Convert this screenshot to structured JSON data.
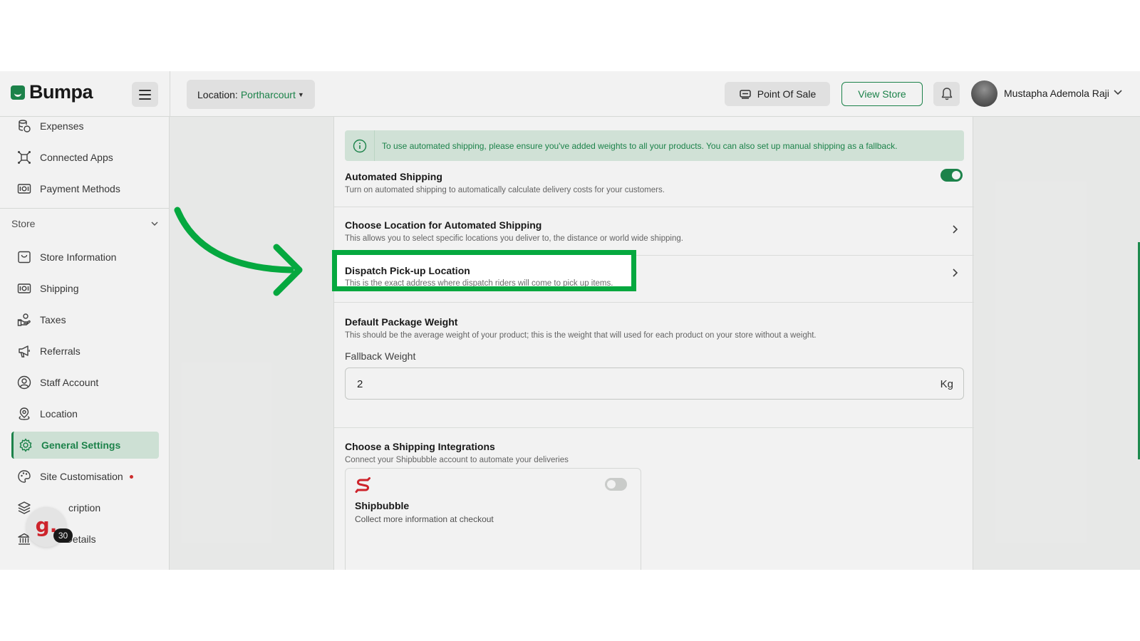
{
  "app": {
    "logo_text": "Bumpa"
  },
  "header": {
    "location_label": "Location:",
    "location_value": "Portharcourt",
    "point_of_sale": "Point Of Sale",
    "view_store": "View Store",
    "user_name": "Mustapha Ademola Raji"
  },
  "sidebar": {
    "top_items": [
      {
        "label": "Expenses"
      },
      {
        "label": "Connected Apps"
      },
      {
        "label": "Payment Methods"
      }
    ],
    "section_label": "Store",
    "store_items": [
      {
        "label": "Store Information"
      },
      {
        "label": "Shipping"
      },
      {
        "label": "Taxes"
      },
      {
        "label": "Referrals"
      },
      {
        "label": "Staff Account"
      },
      {
        "label": "Location"
      },
      {
        "label": "General Settings"
      },
      {
        "label": "Site Customisation"
      },
      {
        "label": "cription"
      },
      {
        "label": "Bank Details"
      }
    ],
    "badge_letter": "g.",
    "badge_count": "30"
  },
  "content": {
    "info_banner": "To use automated shipping, please ensure you've added weights to all your products. You can also set up manual shipping as a fallback.",
    "automated_shipping": {
      "title": "Automated Shipping",
      "desc": "Turn on automated shipping to automatically calculate delivery costs for your customers.",
      "enabled": true
    },
    "choose_location": {
      "title": "Choose Location for Automated Shipping",
      "desc": "This allows you to select specific locations you deliver to, the distance or world wide shipping."
    },
    "dispatch": {
      "title": "Dispatch Pick-up Location",
      "desc": "This is the exact address where dispatch riders will come to pick up items."
    },
    "package_weight": {
      "title": "Default Package Weight",
      "desc": "This should be the average weight of your product; this is the weight that will used for each product on your store without a weight.",
      "input_label": "Fallback Weight",
      "input_value": "2",
      "unit": "Kg"
    },
    "integrations": {
      "title": "Choose a Shipping Integrations",
      "desc": "Connect your Shipbubble account to automate your deliveries",
      "card_title": "Shipbubble",
      "card_desc": "Collect more information at checkout",
      "enabled": false
    }
  },
  "colors": {
    "brand": "#1e8a4e",
    "highlight": "#05a83f",
    "alert": "#d93030"
  }
}
